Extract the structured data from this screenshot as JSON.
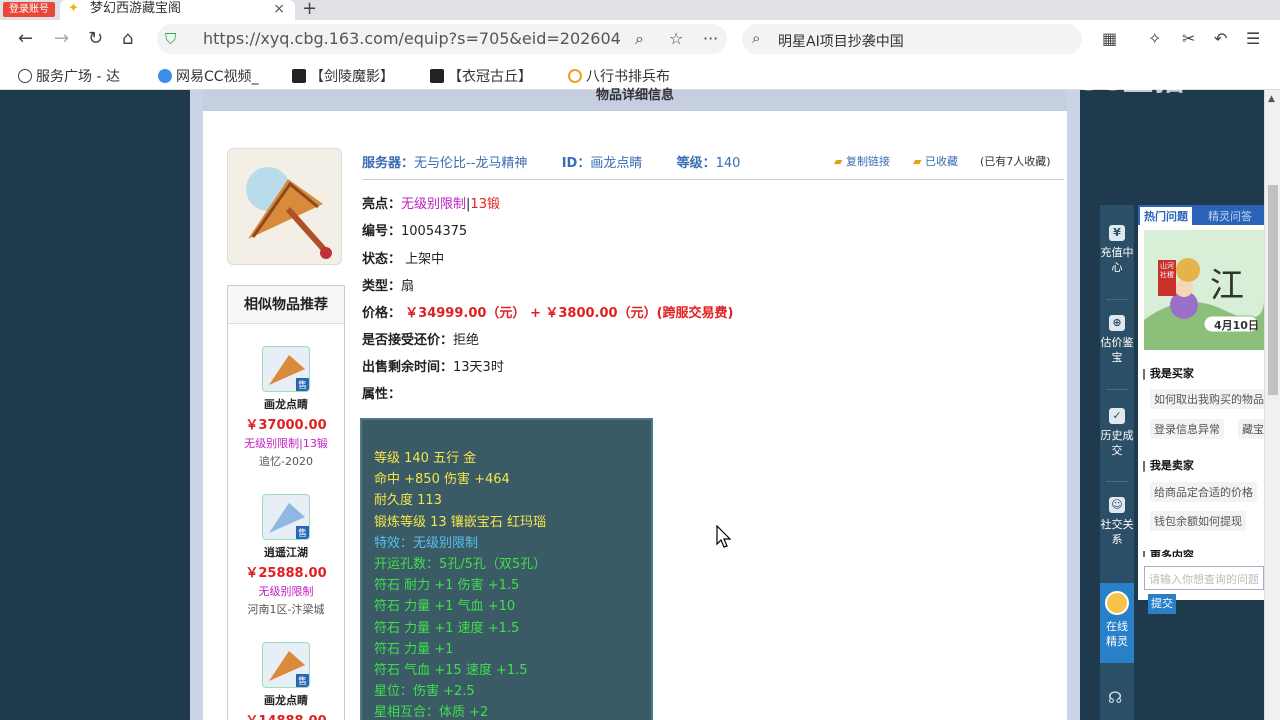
{
  "browser": {
    "login_badge": "登录账号",
    "tab_title": "梦幻西游藏宝阁",
    "tab_close": "×",
    "new_tab": "+",
    "url": "https://xyq.cbg.163.com/equip?s=705&eid=202604",
    "search_text": "明星AI项目抄袭中国",
    "bookmarks": [
      "服务广场 - 达",
      "网易CC视频_",
      "【剑陵魔影】",
      "【衣冠古丘】",
      "八行书排兵布"
    ]
  },
  "panel": {
    "title": "物品详细信息"
  },
  "item": {
    "server_label": "服务器：",
    "server": "无与伦比--龙马精神",
    "id_label": "ID：",
    "id": "画龙点睛",
    "level_label": "等级：",
    "level": "140",
    "copy_link": "复制链接",
    "favorited": "已收藏",
    "fav_count": "(已有7人收藏)",
    "highlight_label": "亮点：",
    "highlight_a": "无级别限制",
    "highlight_sep": "|",
    "highlight_b": "13锻",
    "number_label": "编号：",
    "number": "10054375",
    "status_label": "状态：",
    "status": "上架中",
    "type_label": "类型：",
    "type": "扇",
    "price_label": "价格：",
    "price": "￥34999.00（元） + ￥3800.00（元）(跨服交易费)",
    "counter_label": "是否接受还价：",
    "counter": "拒绝",
    "remaining_label": "出售剩余时间：",
    "remaining": "13天3时",
    "attr_label": "属性："
  },
  "attributes": {
    "yellow": [
      "等级 140  五行 金",
      "命中 +850  伤害 +464",
      "耐久度 113",
      "锻炼等级 13  镶嵌宝石 红玛瑙"
    ],
    "blue": [
      "特效：无级别限制"
    ],
    "green": [
      "开运孔数：5孔/5孔（双5孔）",
      "符石   耐力 +1  伤害 +1.5",
      "符石   力量 +1  气血 +10",
      "符石   力量 +1  速度 +1.5",
      "符石   力量 +1",
      "符石   气血 +15  速度 +1.5",
      "星位：伤害 +2.5",
      "星相互合：体质 +2"
    ]
  },
  "similar": {
    "title": "相似物品推荐",
    "sale_badge": "售",
    "items": [
      {
        "name": "画龙点睛",
        "price": "￥37000.00",
        "tag": "无级别限制|13锻",
        "server": "追忆-2020"
      },
      {
        "name": "逍遥江湖",
        "price": "￥25888.00",
        "tag": "无级别限制",
        "server": "河南1区-汴梁城"
      },
      {
        "name": "画龙点睛",
        "price": "￥14888.00",
        "tag": "",
        "server": ""
      }
    ]
  },
  "side_nav": [
    {
      "label": "充值中心",
      "icon": "wallet-icon"
    },
    {
      "label": "估价鉴宝",
      "icon": "appraise-icon"
    },
    {
      "label": "历史成交",
      "icon": "history-icon"
    },
    {
      "label": "社交关系",
      "icon": "social-icon"
    },
    {
      "label": "在线精灵",
      "icon": "sprite-icon"
    }
  ],
  "help": {
    "tab_hot": "热门问题",
    "tab_sprite": "精灵问答",
    "banner_title": "江",
    "banner_date": "4月10日",
    "banner_tag": "山河社稷",
    "buyer": "我是买家",
    "buyer_q": [
      "如何取出我购买的物品",
      "登录信息异常",
      "藏宝"
    ],
    "seller": "我是卖家",
    "seller_q": [
      "给商品定合适的价格",
      "钱包余额如何提现"
    ],
    "more": "更多内容",
    "input_placeholder": "请输入你想查询的问题",
    "submit": "提交"
  },
  "watermark": "CC直播"
}
